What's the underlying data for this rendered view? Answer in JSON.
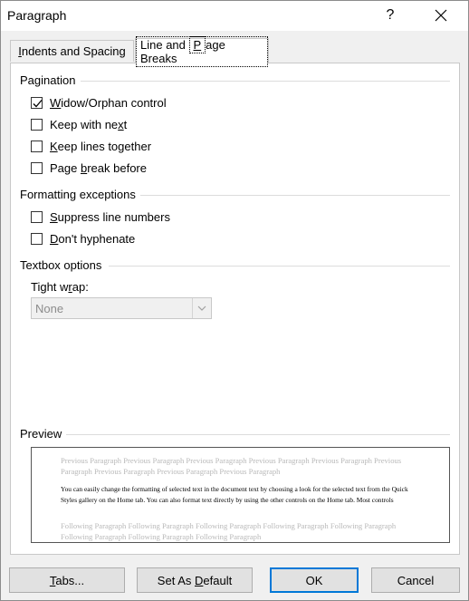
{
  "window": {
    "title": "Paragraph",
    "help_label": "?"
  },
  "tabs": [
    {
      "label": "Indents and Spacing",
      "active": false
    },
    {
      "label": "Line and Page Breaks",
      "active": true
    }
  ],
  "pagination": {
    "heading": "Pagination",
    "options": [
      {
        "label": "Widow/Orphan control",
        "checked": true
      },
      {
        "label": "Keep with next",
        "checked": false
      },
      {
        "label": "Keep lines together",
        "checked": false
      },
      {
        "label": "Page break before",
        "checked": false
      }
    ]
  },
  "formatting_exceptions": {
    "heading": "Formatting exceptions",
    "options": [
      {
        "label": "Suppress line numbers",
        "checked": false
      },
      {
        "label": "Don't hyphenate",
        "checked": false
      }
    ]
  },
  "textbox_options": {
    "heading": "Textbox options",
    "tight_wrap_label": "Tight wrap:",
    "tight_wrap_value": "None"
  },
  "preview": {
    "heading": "Preview",
    "previous_text": "Previous Paragraph Previous Paragraph Previous Paragraph Previous Paragraph Previous Paragraph Previous Paragraph Previous Paragraph Previous Paragraph Previous Paragraph",
    "body_text": "You can easily change the formatting of selected text in the document text by choosing a look for the selected text from the Quick Styles gallery on the Home tab. You can also format text directly by using the other controls on the Home tab. Most controls",
    "following_text": "Following Paragraph Following Paragraph Following Paragraph Following Paragraph Following Paragraph Following Paragraph Following Paragraph Following Paragraph"
  },
  "buttons": {
    "tabs": "Tabs...",
    "set_default": "Set As Default",
    "ok": "OK",
    "cancel": "Cancel"
  }
}
